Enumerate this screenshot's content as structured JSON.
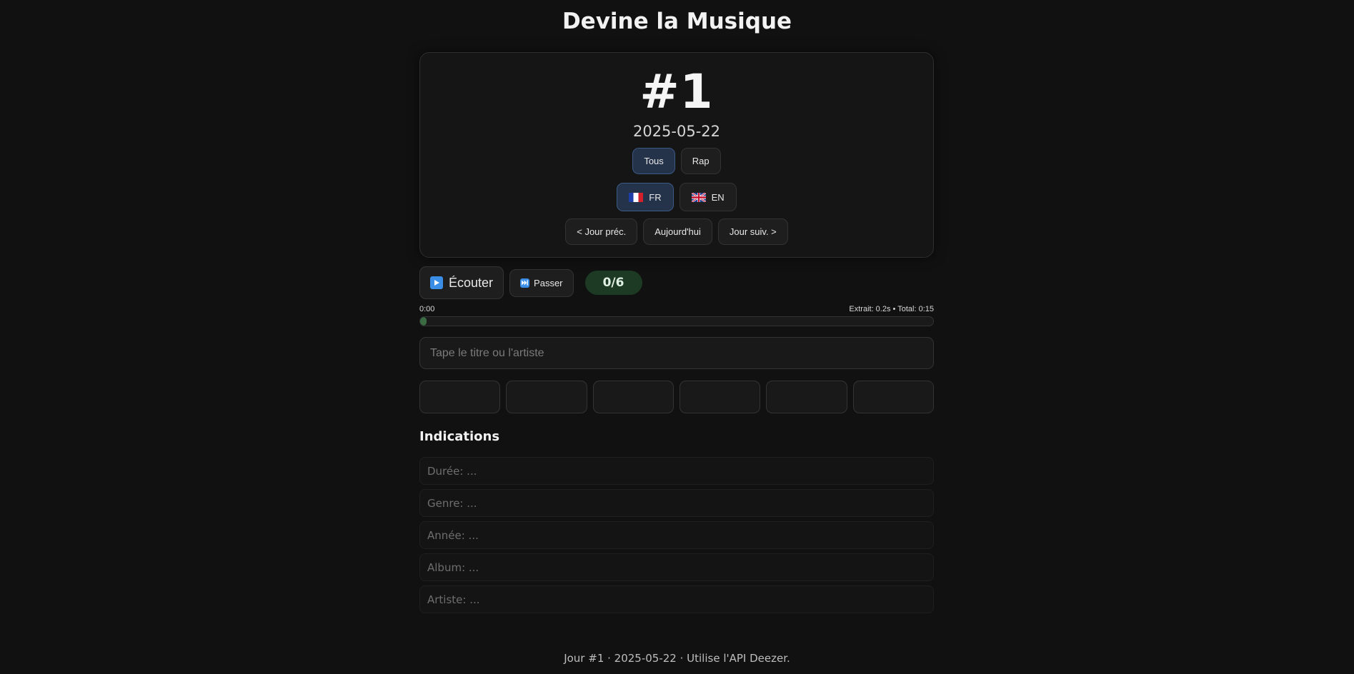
{
  "app": {
    "title": "Devine la Musique"
  },
  "day": {
    "number": "#1",
    "date": "2025-05-22"
  },
  "genres": [
    {
      "label": "Tous",
      "active": true
    },
    {
      "label": "Rap",
      "active": false
    }
  ],
  "languages": [
    {
      "label": "FR",
      "flag": "flag-fr-icon",
      "active": true
    },
    {
      "label": "EN",
      "flag": "flag-gb-icon",
      "active": false
    }
  ],
  "navigation": {
    "prev": "< Jour préc.",
    "today": "Aujourd'hui",
    "next": "Jour suiv. >"
  },
  "player": {
    "listen_label": "Écouter",
    "skip_label": "Passer",
    "score": "0/6",
    "current_time": "0:00",
    "extract_info": "Extrait: 0.2s • Total: 0:15",
    "progress_fraction": 0.013
  },
  "guess": {
    "placeholder": "Tape le titre ou l'artiste"
  },
  "attempts": [
    "",
    "",
    "",
    "",
    "",
    ""
  ],
  "hints": {
    "title": "Indications",
    "items": [
      "Durée: ...",
      "Genre: ...",
      "Année: ...",
      "Album: ...",
      "Artiste: ..."
    ]
  },
  "footer": {
    "text": "Jour #1 · 2025-05-22 · Utilise l'API Deezer."
  },
  "colors": {
    "background": "#111111",
    "accent_active": "#24324a",
    "score_bg": "#1d3a24",
    "progress_fill": "#3b6b43",
    "icon_blue": "#3a8ee6"
  }
}
